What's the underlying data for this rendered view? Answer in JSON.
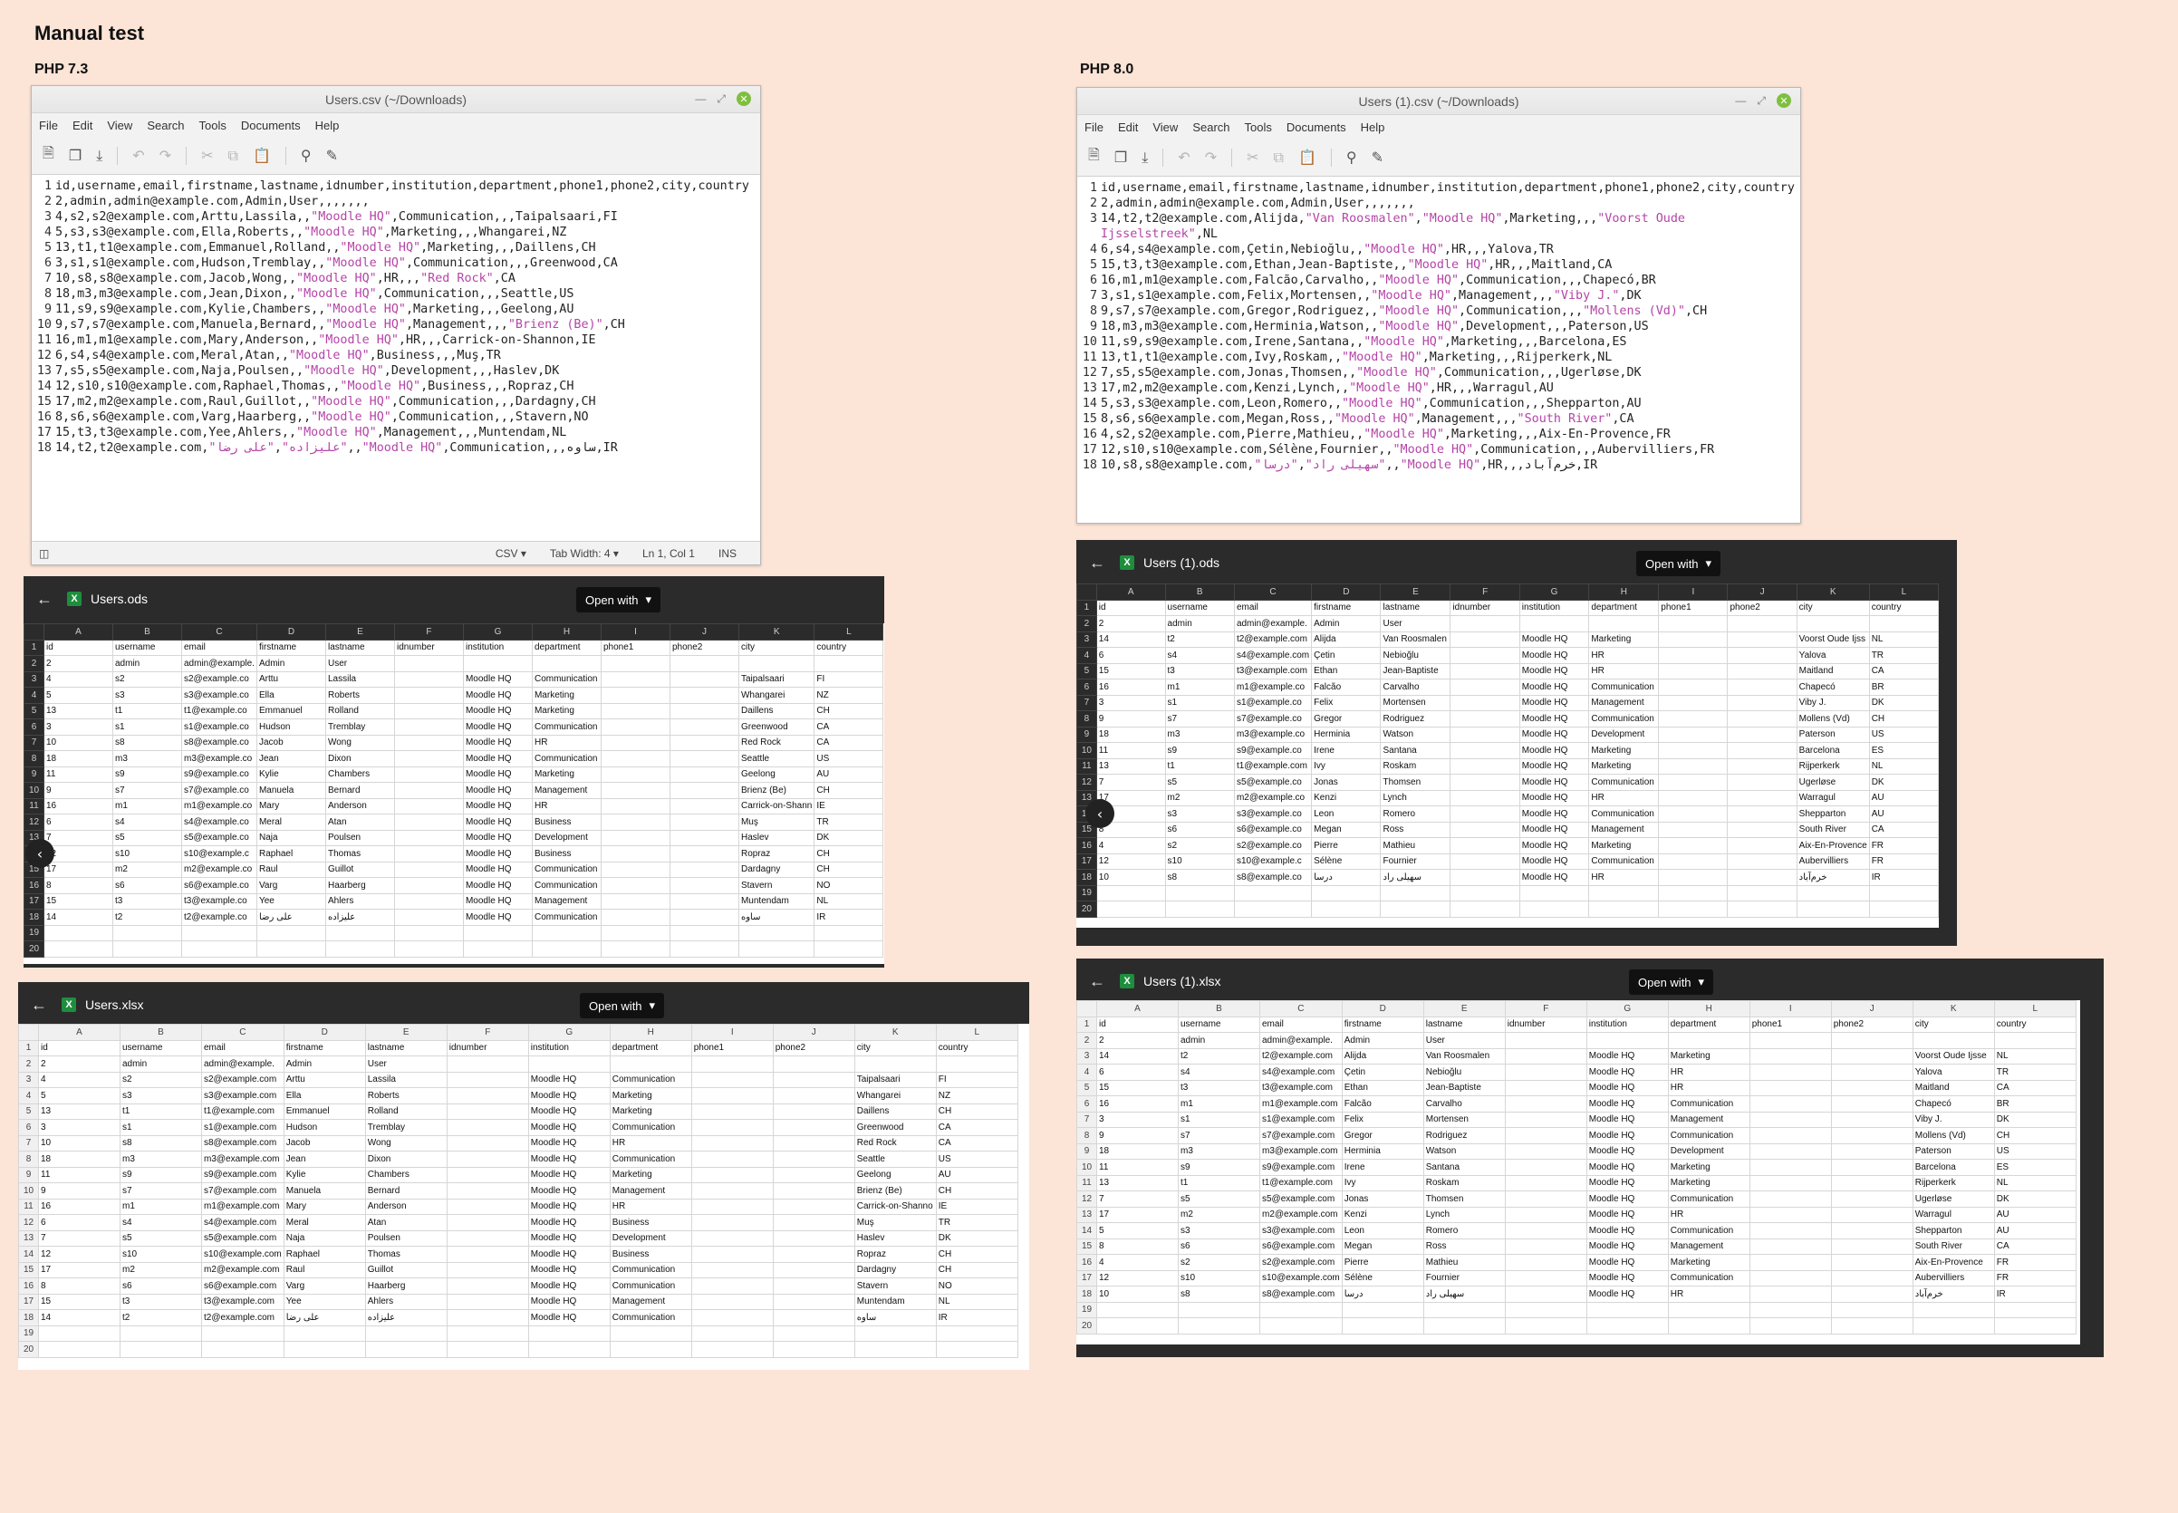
{
  "page": {
    "title": "Manual test",
    "left_label": "PHP 7.3",
    "right_label": "PHP 8.0"
  },
  "menu": [
    "File",
    "Edit",
    "View",
    "Search",
    "Tools",
    "Documents",
    "Help"
  ],
  "editor_left": {
    "title": "Users.csv (~/Downloads)",
    "status": {
      "lang": "CSV",
      "tab": "Tab Width: 4",
      "pos": "Ln 1, Col 1",
      "mode": "INS"
    },
    "lines": [
      "id,username,email,firstname,lastname,idnumber,institution,department,phone1,phone2,city,country",
      "2,admin,admin@example.com,Admin,User,,,,,,,",
      "4,s2,s2@example.com,Arttu,Lassila,,\"Moodle HQ\",Communication,,,Taipalsaari,FI",
      "5,s3,s3@example.com,Ella,Roberts,,\"Moodle HQ\",Marketing,,,Whangarei,NZ",
      "13,t1,t1@example.com,Emmanuel,Rolland,,\"Moodle HQ\",Marketing,,,Daillens,CH",
      "3,s1,s1@example.com,Hudson,Tremblay,,\"Moodle HQ\",Communication,,,Greenwood,CA",
      "10,s8,s8@example.com,Jacob,Wong,,\"Moodle HQ\",HR,,,\"Red Rock\",CA",
      "18,m3,m3@example.com,Jean,Dixon,,\"Moodle HQ\",Communication,,,Seattle,US",
      "11,s9,s9@example.com,Kylie,Chambers,,\"Moodle HQ\",Marketing,,,Geelong,AU",
      "9,s7,s7@example.com,Manuela,Bernard,,\"Moodle HQ\",Management,,,\"Brienz (Be)\",CH",
      "16,m1,m1@example.com,Mary,Anderson,,\"Moodle HQ\",HR,,,Carrick-on-Shannon,IE",
      "6,s4,s4@example.com,Meral,Atan,,\"Moodle HQ\",Business,,,Muş,TR",
      "7,s5,s5@example.com,Naja,Poulsen,,\"Moodle HQ\",Development,,,Haslev,DK",
      "12,s10,s10@example.com,Raphael,Thomas,,\"Moodle HQ\",Business,,,Ropraz,CH",
      "17,m2,m2@example.com,Raul,Guillot,,\"Moodle HQ\",Communication,,,Dardagny,CH",
      "8,s6,s6@example.com,Varg,Haarberg,,\"Moodle HQ\",Communication,,,Stavern,NO",
      "15,t3,t3@example.com,Yee,Ahlers,,\"Moodle HQ\",Management,,,Muntendam,NL",
      "14,t2,t2@example.com,\"علیزاده\",\"علی رضا\",,\"Moodle HQ\",Communication,,,ساوه,IR"
    ]
  },
  "editor_right": {
    "title": "Users (1).csv (~/Downloads)",
    "lines": [
      "id,username,email,firstname,lastname,idnumber,institution,department,phone1,phone2,city,country",
      "2,admin,admin@example.com,Admin,User,,,,,,,",
      "14,t2,t2@example.com,Alijda,\"Van Roosmalen\",\"Moodle HQ\",Marketing,,,\"Voorst Oude Ijsselstreek\",NL",
      "6,s4,s4@example.com,Çetin,Nebioğlu,,\"Moodle HQ\",HR,,,Yalova,TR",
      "15,t3,t3@example.com,Ethan,Jean-Baptiste,,\"Moodle HQ\",HR,,,Maitland,CA",
      "16,m1,m1@example.com,Falcão,Carvalho,,\"Moodle HQ\",Communication,,,Chapecó,BR",
      "3,s1,s1@example.com,Felix,Mortensen,,\"Moodle HQ\",Management,,,\"Viby J.\",DK",
      "9,s7,s7@example.com,Gregor,Rodriguez,,\"Moodle HQ\",Communication,,,\"Mollens (Vd)\",CH",
      "18,m3,m3@example.com,Herminia,Watson,,\"Moodle HQ\",Development,,,Paterson,US",
      "11,s9,s9@example.com,Irene,Santana,,\"Moodle HQ\",Marketing,,,Barcelona,ES",
      "13,t1,t1@example.com,Ivy,Roskam,,\"Moodle HQ\",Marketing,,,Rijperkerk,NL",
      "7,s5,s5@example.com,Jonas,Thomsen,,\"Moodle HQ\",Communication,,,Ugerløse,DK",
      "17,m2,m2@example.com,Kenzi,Lynch,,\"Moodle HQ\",HR,,,Warragul,AU",
      "5,s3,s3@example.com,Leon,Romero,,\"Moodle HQ\",Communication,,,Shepparton,AU",
      "8,s6,s6@example.com,Megan,Ross,,\"Moodle HQ\",Management,,,\"South River\",CA",
      "4,s2,s2@example.com,Pierre,Mathieu,,\"Moodle HQ\",Marketing,,,Aix-En-Provence,FR",
      "12,s10,s10@example.com,Sélène,Fournier,,\"Moodle HQ\",Communication,,,Aubervilliers,FR",
      "10,s8,s8@example.com,\"سهیلی راد\",\"درسا\",,\"Moodle HQ\",HR,,,خرم‌آباد,IR"
    ]
  },
  "open_with": "Open with",
  "columns": [
    "A",
    "B",
    "C",
    "D",
    "E",
    "F",
    "G",
    "H",
    "I",
    "J",
    "K",
    "L"
  ],
  "php73": {
    "ods_name": "Users.ods",
    "xlsx_name": "Users.xlsx",
    "ods_rows": [
      [
        "id",
        "username",
        "email",
        "firstname",
        "lastname",
        "idnumber",
        "institution",
        "department",
        "phone1",
        "phone2",
        "city",
        "country"
      ],
      [
        "2",
        "admin",
        "admin@example.",
        "Admin",
        "User",
        "",
        "",
        "",
        "",
        "",
        "",
        ""
      ],
      [
        "4",
        "s2",
        "s2@example.co",
        "Arttu",
        "Lassila",
        "",
        "Moodle HQ",
        "Communication",
        "",
        "",
        "Taipalsaari",
        "FI"
      ],
      [
        "5",
        "s3",
        "s3@example.co",
        "Ella",
        "Roberts",
        "",
        "Moodle HQ",
        "Marketing",
        "",
        "",
        "Whangarei",
        "NZ"
      ],
      [
        "13",
        "t1",
        "t1@example.co",
        "Emmanuel",
        "Rolland",
        "",
        "Moodle HQ",
        "Marketing",
        "",
        "",
        "Daillens",
        "CH"
      ],
      [
        "3",
        "s1",
        "s1@example.co",
        "Hudson",
        "Tremblay",
        "",
        "Moodle HQ",
        "Communication",
        "",
        "",
        "Greenwood",
        "CA"
      ],
      [
        "10",
        "s8",
        "s8@example.co",
        "Jacob",
        "Wong",
        "",
        "Moodle HQ",
        "HR",
        "",
        "",
        "Red Rock",
        "CA"
      ],
      [
        "18",
        "m3",
        "m3@example.co",
        "Jean",
        "Dixon",
        "",
        "Moodle HQ",
        "Communication",
        "",
        "",
        "Seattle",
        "US"
      ],
      [
        "11",
        "s9",
        "s9@example.co",
        "Kylie",
        "Chambers",
        "",
        "Moodle HQ",
        "Marketing",
        "",
        "",
        "Geelong",
        "AU"
      ],
      [
        "9",
        "s7",
        "s7@example.co",
        "Manuela",
        "Bernard",
        "",
        "Moodle HQ",
        "Management",
        "",
        "",
        "Brienz (Be)",
        "CH"
      ],
      [
        "16",
        "m1",
        "m1@example.co",
        "Mary",
        "Anderson",
        "",
        "Moodle HQ",
        "HR",
        "",
        "",
        "Carrick-on-Shann",
        "IE"
      ],
      [
        "6",
        "s4",
        "s4@example.co",
        "Meral",
        "Atan",
        "",
        "Moodle HQ",
        "Business",
        "",
        "",
        "Muş",
        "TR"
      ],
      [
        "7",
        "s5",
        "s5@example.co",
        "Naja",
        "Poulsen",
        "",
        "Moodle HQ",
        "Development",
        "",
        "",
        "Haslev",
        "DK"
      ],
      [
        "12",
        "s10",
        "s10@example.c",
        "Raphael",
        "Thomas",
        "",
        "Moodle HQ",
        "Business",
        "",
        "",
        "Ropraz",
        "CH"
      ],
      [
        "17",
        "m2",
        "m2@example.co",
        "Raul",
        "Guillot",
        "",
        "Moodle HQ",
        "Communication",
        "",
        "",
        "Dardagny",
        "CH"
      ],
      [
        "8",
        "s6",
        "s6@example.co",
        "Varg",
        "Haarberg",
        "",
        "Moodle HQ",
        "Communication",
        "",
        "",
        "Stavern",
        "NO"
      ],
      [
        "15",
        "t3",
        "t3@example.co",
        "Yee",
        "Ahlers",
        "",
        "Moodle HQ",
        "Management",
        "",
        "",
        "Muntendam",
        "NL"
      ],
      [
        "14",
        "t2",
        "t2@example.co",
        "علی رضا",
        "علیزاده",
        "",
        "Moodle HQ",
        "Communication",
        "",
        "",
        "ساوه",
        "IR"
      ]
    ],
    "xlsx_rows": [
      [
        "id",
        "username",
        "email",
        "firstname",
        "lastname",
        "idnumber",
        "institution",
        "department",
        "phone1",
        "phone2",
        "city",
        "country"
      ],
      [
        "2",
        "admin",
        "admin@example.",
        "Admin",
        "User",
        "",
        "",
        "",
        "",
        "",
        "",
        ""
      ],
      [
        "4",
        "s2",
        "s2@example.com",
        "Arttu",
        "Lassila",
        "",
        "Moodle HQ",
        "Communication",
        "",
        "",
        "Taipalsaari",
        "FI"
      ],
      [
        "5",
        "s3",
        "s3@example.com",
        "Ella",
        "Roberts",
        "",
        "Moodle HQ",
        "Marketing",
        "",
        "",
        "Whangarei",
        "NZ"
      ],
      [
        "13",
        "t1",
        "t1@example.com",
        "Emmanuel",
        "Rolland",
        "",
        "Moodle HQ",
        "Marketing",
        "",
        "",
        "Daillens",
        "CH"
      ],
      [
        "3",
        "s1",
        "s1@example.com",
        "Hudson",
        "Tremblay",
        "",
        "Moodle HQ",
        "Communication",
        "",
        "",
        "Greenwood",
        "CA"
      ],
      [
        "10",
        "s8",
        "s8@example.com",
        "Jacob",
        "Wong",
        "",
        "Moodle HQ",
        "HR",
        "",
        "",
        "Red Rock",
        "CA"
      ],
      [
        "18",
        "m3",
        "m3@example.com",
        "Jean",
        "Dixon",
        "",
        "Moodle HQ",
        "Communication",
        "",
        "",
        "Seattle",
        "US"
      ],
      [
        "11",
        "s9",
        "s9@example.com",
        "Kylie",
        "Chambers",
        "",
        "Moodle HQ",
        "Marketing",
        "",
        "",
        "Geelong",
        "AU"
      ],
      [
        "9",
        "s7",
        "s7@example.com",
        "Manuela",
        "Bernard",
        "",
        "Moodle HQ",
        "Management",
        "",
        "",
        "Brienz (Be)",
        "CH"
      ],
      [
        "16",
        "m1",
        "m1@example.com",
        "Mary",
        "Anderson",
        "",
        "Moodle HQ",
        "HR",
        "",
        "",
        "Carrick-on-Shanno",
        "IE"
      ],
      [
        "6",
        "s4",
        "s4@example.com",
        "Meral",
        "Atan",
        "",
        "Moodle HQ",
        "Business",
        "",
        "",
        "Muş",
        "TR"
      ],
      [
        "7",
        "s5",
        "s5@example.com",
        "Naja",
        "Poulsen",
        "",
        "Moodle HQ",
        "Development",
        "",
        "",
        "Haslev",
        "DK"
      ],
      [
        "12",
        "s10",
        "s10@example.com",
        "Raphael",
        "Thomas",
        "",
        "Moodle HQ",
        "Business",
        "",
        "",
        "Ropraz",
        "CH"
      ],
      [
        "17",
        "m2",
        "m2@example.com",
        "Raul",
        "Guillot",
        "",
        "Moodle HQ",
        "Communication",
        "",
        "",
        "Dardagny",
        "CH"
      ],
      [
        "8",
        "s6",
        "s6@example.com",
        "Varg",
        "Haarberg",
        "",
        "Moodle HQ",
        "Communication",
        "",
        "",
        "Stavern",
        "NO"
      ],
      [
        "15",
        "t3",
        "t3@example.com",
        "Yee",
        "Ahlers",
        "",
        "Moodle HQ",
        "Management",
        "",
        "",
        "Muntendam",
        "NL"
      ],
      [
        "14",
        "t2",
        "t2@example.com",
        "علی رضا",
        "علیزاده",
        "",
        "Moodle HQ",
        "Communication",
        "",
        "",
        "ساوه",
        "IR"
      ]
    ]
  },
  "php80": {
    "ods_name": "Users (1).ods",
    "xlsx_name": "Users (1).xlsx",
    "ods_rows": [
      [
        "id",
        "username",
        "email",
        "firstname",
        "lastname",
        "idnumber",
        "institution",
        "department",
        "phone1",
        "phone2",
        "city",
        "country"
      ],
      [
        "2",
        "admin",
        "admin@example.",
        "Admin",
        "User",
        "",
        "",
        "",
        "",
        "",
        "",
        ""
      ],
      [
        "14",
        "t2",
        "t2@example.com",
        "Alijda",
        "Van Roosmalen",
        "",
        "Moodle HQ",
        "Marketing",
        "",
        "",
        "Voorst Oude Ijss",
        "NL"
      ],
      [
        "6",
        "s4",
        "s4@example.com",
        "Çetin",
        "Nebioğlu",
        "",
        "Moodle HQ",
        "HR",
        "",
        "",
        "Yalova",
        "TR"
      ],
      [
        "15",
        "t3",
        "t3@example.com",
        "Ethan",
        "Jean-Baptiste",
        "",
        "Moodle HQ",
        "HR",
        "",
        "",
        "Maitland",
        "CA"
      ],
      [
        "16",
        "m1",
        "m1@example.co",
        "Falcão",
        "Carvalho",
        "",
        "Moodle HQ",
        "Communication",
        "",
        "",
        "Chapecó",
        "BR"
      ],
      [
        "3",
        "s1",
        "s1@example.co",
        "Felix",
        "Mortensen",
        "",
        "Moodle HQ",
        "Management",
        "",
        "",
        "Viby J.",
        "DK"
      ],
      [
        "9",
        "s7",
        "s7@example.co",
        "Gregor",
        "Rodriguez",
        "",
        "Moodle HQ",
        "Communication",
        "",
        "",
        "Mollens (Vd)",
        "CH"
      ],
      [
        "18",
        "m3",
        "m3@example.co",
        "Herminia",
        "Watson",
        "",
        "Moodle HQ",
        "Development",
        "",
        "",
        "Paterson",
        "US"
      ],
      [
        "11",
        "s9",
        "s9@example.co",
        "Irene",
        "Santana",
        "",
        "Moodle HQ",
        "Marketing",
        "",
        "",
        "Barcelona",
        "ES"
      ],
      [
        "13",
        "t1",
        "t1@example.com",
        "Ivy",
        "Roskam",
        "",
        "Moodle HQ",
        "Marketing",
        "",
        "",
        "Rijperkerk",
        "NL"
      ],
      [
        "7",
        "s5",
        "s5@example.co",
        "Jonas",
        "Thomsen",
        "",
        "Moodle HQ",
        "Communication",
        "",
        "",
        "Ugerløse",
        "DK"
      ],
      [
        "17",
        "m2",
        "m2@example.co",
        "Kenzi",
        "Lynch",
        "",
        "Moodle HQ",
        "HR",
        "",
        "",
        "Warragul",
        "AU"
      ],
      [
        "5",
        "s3",
        "s3@example.co",
        "Leon",
        "Romero",
        "",
        "Moodle HQ",
        "Communication",
        "",
        "",
        "Shepparton",
        "AU"
      ],
      [
        "8",
        "s6",
        "s6@example.co",
        "Megan",
        "Ross",
        "",
        "Moodle HQ",
        "Management",
        "",
        "",
        "South River",
        "CA"
      ],
      [
        "4",
        "s2",
        "s2@example.co",
        "Pierre",
        "Mathieu",
        "",
        "Moodle HQ",
        "Marketing",
        "",
        "",
        "Aix-En-Provence",
        "FR"
      ],
      [
        "12",
        "s10",
        "s10@example.c",
        "Sélène",
        "Fournier",
        "",
        "Moodle HQ",
        "Communication",
        "",
        "",
        "Aubervilliers",
        "FR"
      ],
      [
        "10",
        "s8",
        "s8@example.co",
        "درسا",
        "سهیلی راد",
        "",
        "Moodle HQ",
        "HR",
        "",
        "",
        "خرم‌آباد",
        "IR"
      ]
    ],
    "xlsx_rows": [
      [
        "id",
        "username",
        "email",
        "firstname",
        "lastname",
        "idnumber",
        "institution",
        "department",
        "phone1",
        "phone2",
        "city",
        "country"
      ],
      [
        "2",
        "admin",
        "admin@example.",
        "Admin",
        "User",
        "",
        "",
        "",
        "",
        "",
        "",
        ""
      ],
      [
        "14",
        "t2",
        "t2@example.com",
        "Alijda",
        "Van Roosmalen",
        "",
        "Moodle HQ",
        "Marketing",
        "",
        "",
        "Voorst Oude Ijsse",
        "NL"
      ],
      [
        "6",
        "s4",
        "s4@example.com",
        "Çetin",
        "Nebioğlu",
        "",
        "Moodle HQ",
        "HR",
        "",
        "",
        "Yalova",
        "TR"
      ],
      [
        "15",
        "t3",
        "t3@example.com",
        "Ethan",
        "Jean-Baptiste",
        "",
        "Moodle HQ",
        "HR",
        "",
        "",
        "Maitland",
        "CA"
      ],
      [
        "16",
        "m1",
        "m1@example.com",
        "Falcão",
        "Carvalho",
        "",
        "Moodle HQ",
        "Communication",
        "",
        "",
        "Chapecó",
        "BR"
      ],
      [
        "3",
        "s1",
        "s1@example.com",
        "Felix",
        "Mortensen",
        "",
        "Moodle HQ",
        "Management",
        "",
        "",
        "Viby J.",
        "DK"
      ],
      [
        "9",
        "s7",
        "s7@example.com",
        "Gregor",
        "Rodriguez",
        "",
        "Moodle HQ",
        "Communication",
        "",
        "",
        "Mollens (Vd)",
        "CH"
      ],
      [
        "18",
        "m3",
        "m3@example.com",
        "Herminia",
        "Watson",
        "",
        "Moodle HQ",
        "Development",
        "",
        "",
        "Paterson",
        "US"
      ],
      [
        "11",
        "s9",
        "s9@example.com",
        "Irene",
        "Santana",
        "",
        "Moodle HQ",
        "Marketing",
        "",
        "",
        "Barcelona",
        "ES"
      ],
      [
        "13",
        "t1",
        "t1@example.com",
        "Ivy",
        "Roskam",
        "",
        "Moodle HQ",
        "Marketing",
        "",
        "",
        "Rijperkerk",
        "NL"
      ],
      [
        "7",
        "s5",
        "s5@example.com",
        "Jonas",
        "Thomsen",
        "",
        "Moodle HQ",
        "Communication",
        "",
        "",
        "Ugerløse",
        "DK"
      ],
      [
        "17",
        "m2",
        "m2@example.com",
        "Kenzi",
        "Lynch",
        "",
        "Moodle HQ",
        "HR",
        "",
        "",
        "Warragul",
        "AU"
      ],
      [
        "5",
        "s3",
        "s3@example.com",
        "Leon",
        "Romero",
        "",
        "Moodle HQ",
        "Communication",
        "",
        "",
        "Shepparton",
        "AU"
      ],
      [
        "8",
        "s6",
        "s6@example.com",
        "Megan",
        "Ross",
        "",
        "Moodle HQ",
        "Management",
        "",
        "",
        "South River",
        "CA"
      ],
      [
        "4",
        "s2",
        "s2@example.com",
        "Pierre",
        "Mathieu",
        "",
        "Moodle HQ",
        "Marketing",
        "",
        "",
        "Aix-En-Provence",
        "FR"
      ],
      [
        "12",
        "s10",
        "s10@example.com",
        "Sélène",
        "Fournier",
        "",
        "Moodle HQ",
        "Communication",
        "",
        "",
        "Aubervilliers",
        "FR"
      ],
      [
        "10",
        "s8",
        "s8@example.com",
        "درسا",
        "سهیلی راد",
        "",
        "Moodle HQ",
        "HR",
        "",
        "",
        "خرم‌آباد",
        "IR"
      ]
    ]
  }
}
